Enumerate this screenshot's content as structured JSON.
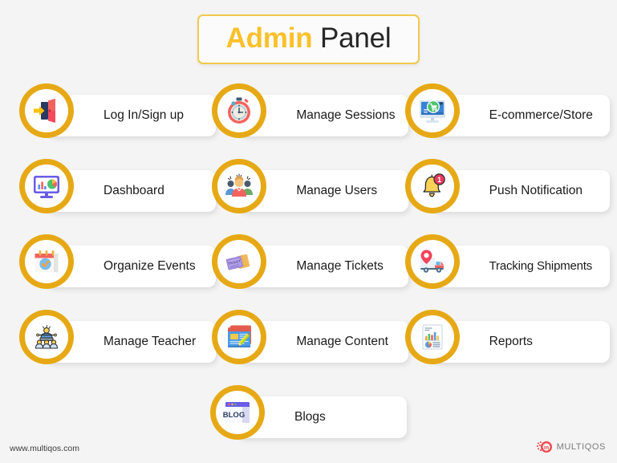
{
  "header": {
    "title_accent": "Admin",
    "title_rest": " Panel"
  },
  "colors": {
    "background": "#f4f4f4",
    "ring_gold": "#e6a915",
    "title_accent": "#fcc02a",
    "title_border": "#f2c94c",
    "card_white": "#ffffff",
    "text_dark": "#1a1a1a",
    "brand_red": "#f0484f"
  },
  "grid": {
    "rows": [
      [
        {
          "label": "Log In/Sign up",
          "icon": "door-login-icon"
        },
        {
          "label": "Manage Sessions",
          "icon": "stopwatch-icon"
        },
        {
          "label": "E-commerce/Store",
          "icon": "monitor-cart-icon"
        }
      ],
      [
        {
          "label": "Dashboard",
          "icon": "monitor-chart-icon"
        },
        {
          "label": "Manage Users",
          "icon": "users-group-icon"
        },
        {
          "label": "Push Notification",
          "icon": "bell-badge-icon",
          "badge": "1"
        }
      ],
      [
        {
          "label": "Organize Events",
          "icon": "calendar-check-icon"
        },
        {
          "label": "Manage Tickets",
          "icon": "tickets-icon",
          "icon_text": "TICKET"
        },
        {
          "label": "Tracking Shipments",
          "icon": "delivery-truck-pin-icon"
        }
      ],
      [
        {
          "label": "Manage Teacher",
          "icon": "teacher-students-icon"
        },
        {
          "label": "Manage Content",
          "icon": "document-pencil-icon"
        },
        {
          "label": "Reports",
          "icon": "report-chart-icon"
        }
      ],
      [
        {
          "label": "Blogs",
          "icon": "blog-window-icon",
          "icon_text": "BLOG"
        }
      ]
    ]
  },
  "footer": {
    "url": "www.multiqos.com",
    "brand_name": "MULTIQOS",
    "brand_mark": "m"
  }
}
